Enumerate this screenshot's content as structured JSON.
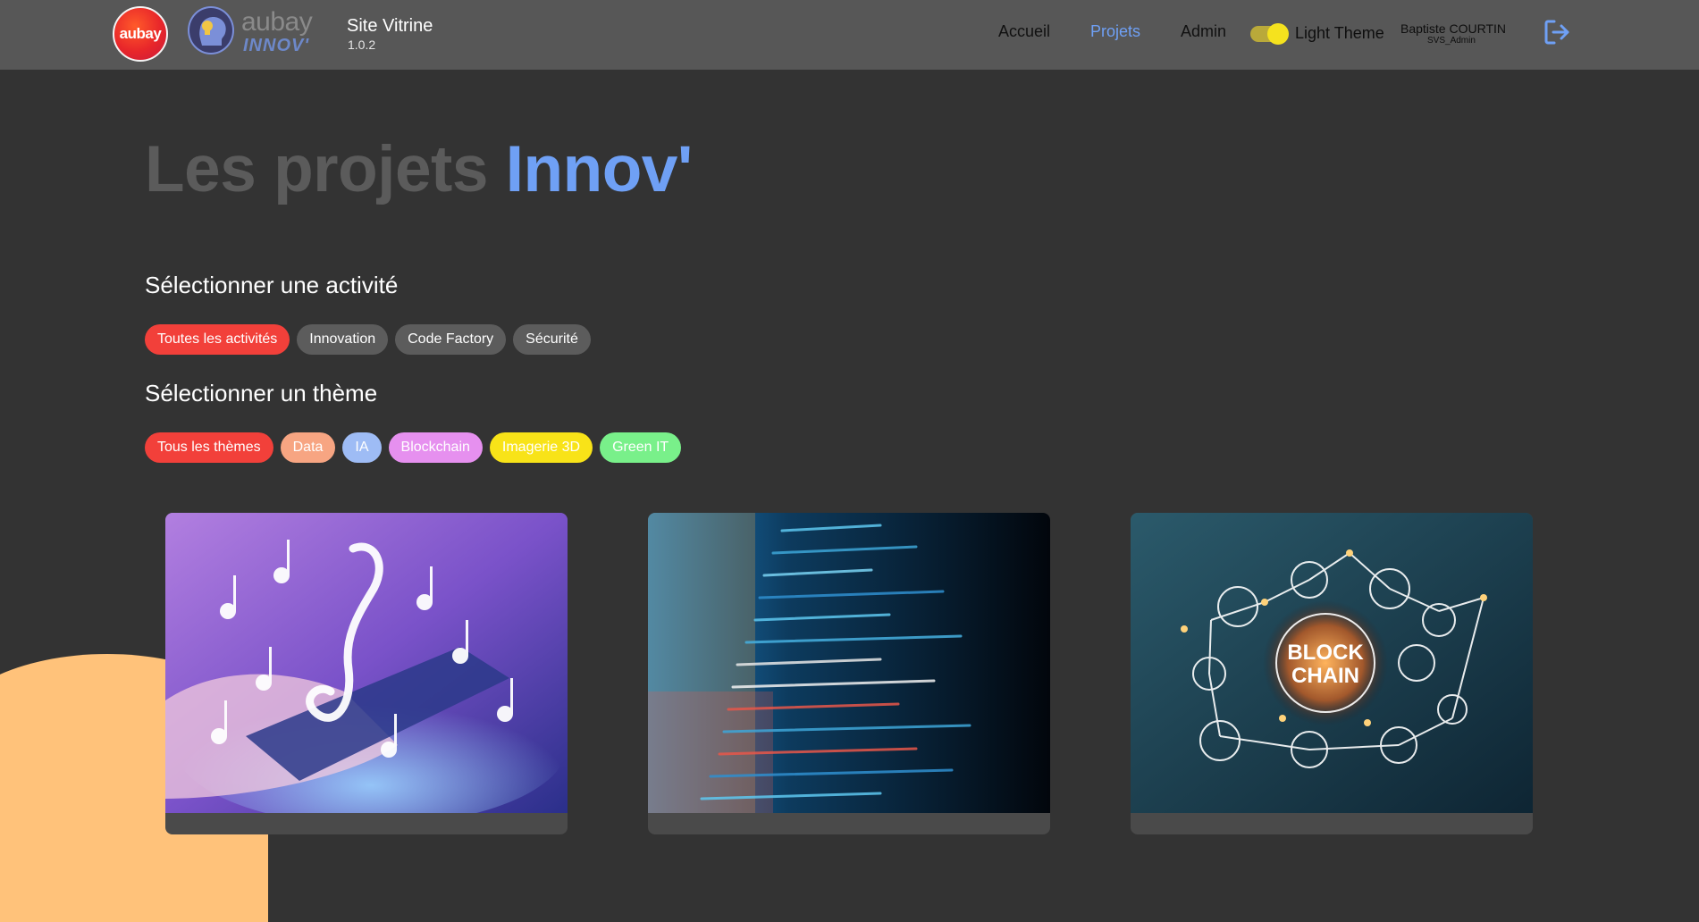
{
  "header": {
    "logo_text": "aubay",
    "logo_innov_word": "aubay",
    "logo_innov_sub": "INNOV'",
    "site_title": "Site Vitrine",
    "version": "1.0.2",
    "nav": [
      {
        "label": "Accueil",
        "active": false
      },
      {
        "label": "Projets",
        "active": true
      },
      {
        "label": "Admin",
        "active": false
      }
    ],
    "theme_label": "Light Theme",
    "theme_toggle_on": true,
    "user": {
      "name": "Baptiste COURTIN",
      "role": "SVS_Admin"
    }
  },
  "hero": {
    "part1": "Les projets",
    "part2": "Innov'"
  },
  "activity": {
    "title": "Sélectionner une activité",
    "chips": [
      {
        "label": "Toutes les activités",
        "color": "#f2403a"
      },
      {
        "label": "Innovation",
        "color": "#5c5c5c"
      },
      {
        "label": "Code Factory",
        "color": "#5c5c5c"
      },
      {
        "label": "Sécurité",
        "color": "#5c5c5c"
      }
    ]
  },
  "theme": {
    "title": "Sélectionner un thème",
    "chips": [
      {
        "label": "Tous les thèmes",
        "color": "#f2403a"
      },
      {
        "label": "Data",
        "color": "#f7a582"
      },
      {
        "label": "IA",
        "color": "#9ebcf5"
      },
      {
        "label": "Blockchain",
        "color": "#e690ef"
      },
      {
        "label": "Imagerie 3D",
        "color": "#f8e318"
      },
      {
        "label": "Green IT",
        "color": "#79f08a"
      }
    ]
  },
  "cards": [
    {
      "image": "music-notes-smartphone-image",
      "block_text": ""
    },
    {
      "image": "source-code-screen-image",
      "block_text": ""
    },
    {
      "image": "blockchain-network-image",
      "block_text": "BLOCK CHAIN"
    }
  ],
  "colors": {
    "accent_blue": "#6fa0f5",
    "accent_red": "#f2403a",
    "bg": "#333333",
    "header_bg": "#575757"
  }
}
